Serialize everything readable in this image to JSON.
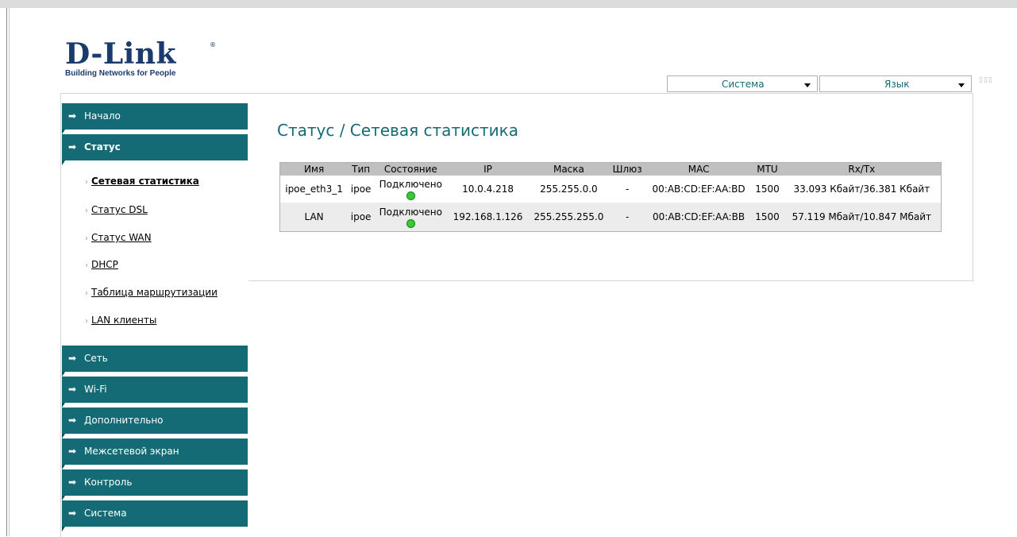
{
  "brand": {
    "logo_text": "D-Link",
    "registered": "®",
    "tagline": "Building Networks for People"
  },
  "header": {
    "system_dropdown": "Система",
    "language_dropdown": "Язык",
    "tray_text": "▯▯▯"
  },
  "sidebar": {
    "items": [
      {
        "label": "Начало",
        "active": false
      },
      {
        "label": "Статус",
        "active": true
      },
      {
        "label": "Сеть",
        "active": false
      },
      {
        "label": "Wi-Fi",
        "active": false
      },
      {
        "label": "Дополнительно",
        "active": false
      },
      {
        "label": "Межсетевой экран",
        "active": false
      },
      {
        "label": "Контроль",
        "active": false
      },
      {
        "label": "Система",
        "active": false
      }
    ],
    "submenu": [
      {
        "label": "Сетевая статистика",
        "active": true
      },
      {
        "label": "Статус DSL",
        "active": false
      },
      {
        "label": "Статус WAN",
        "active": false
      },
      {
        "label": "DHCP",
        "active": false
      },
      {
        "label": "Таблица маршрутизации",
        "active": false
      },
      {
        "label": "LAN клиенты",
        "active": false
      }
    ]
  },
  "main": {
    "title": "Статус / Сетевая статистика",
    "table": {
      "headers": [
        "Имя",
        "Тип",
        "Состояние",
        "IP",
        "Маска",
        "Шлюз",
        "MAC",
        "MTU",
        "Rx/Tx"
      ],
      "rows": [
        {
          "name": "ipoe_eth3_1",
          "type": "ipoe",
          "state": "Подключено",
          "ip": "10.0.4.218",
          "mask": "255.255.0.0",
          "gateway": "-",
          "mac": "00:AB:CD:EF:AA:BD",
          "mtu": "1500",
          "rxtx": "33.093 Кбайт/36.381 Кбайт"
        },
        {
          "name": "LAN",
          "type": "ipoe",
          "state": "Подключено",
          "ip": "192.168.1.126",
          "mask": "255.255.255.0",
          "gateway": "-",
          "mac": "00:AB:CD:EF:AA:BB",
          "mtu": "1500",
          "rxtx": "57.119 Мбайт/10.847 Мбайт"
        }
      ]
    }
  },
  "colors": {
    "accent": "#146b76",
    "status_connected": "#33cc33",
    "table_header": "#c0c0c0"
  }
}
